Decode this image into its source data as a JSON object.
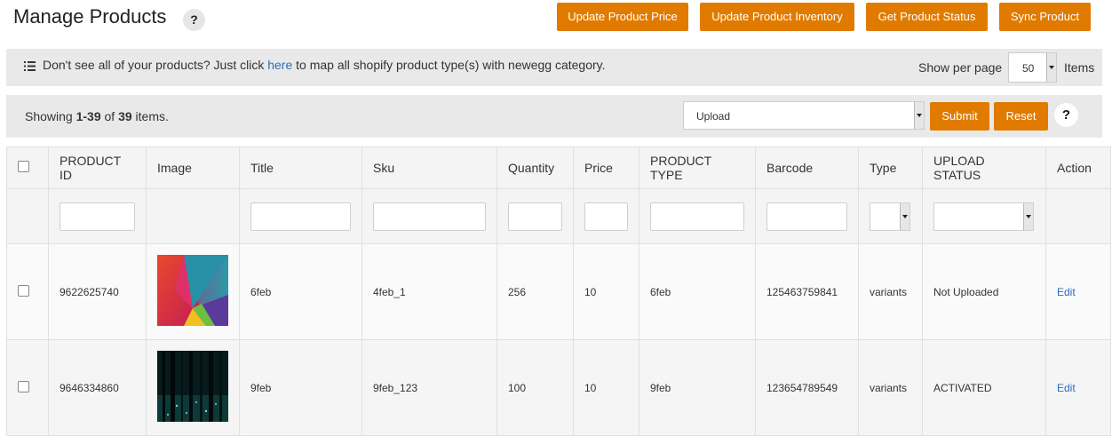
{
  "page": {
    "title": "Manage Products",
    "help_label": "?"
  },
  "toolbar": {
    "update_price": "Update Product Price",
    "update_inventory": "Update Product Inventory",
    "get_status": "Get Product Status",
    "sync_product": "Sync Product"
  },
  "notice": {
    "prefix": "Don't see all of your products? Just click ",
    "link": "here",
    "suffix": " to map all shopify product type(s) with newegg category.",
    "show_per_page_label": "Show per page",
    "per_page_value": "50",
    "items_label": "Items"
  },
  "summary": {
    "showing_prefix": "Showing ",
    "range": "1-39",
    "of": " of ",
    "total": "39",
    "items_suffix": " items."
  },
  "bulk": {
    "action_value": "Upload",
    "submit": "Submit",
    "reset": "Reset",
    "help": "?"
  },
  "table": {
    "headers": {
      "product_id": "PRODUCT ID",
      "image": "Image",
      "title": "Title",
      "sku": "Sku",
      "quantity": "Quantity",
      "price": "Price",
      "product_type": "PRODUCT TYPE",
      "barcode": "Barcode",
      "type": "Type",
      "upload_status": "UPLOAD STATUS",
      "action": "Action"
    },
    "rows": [
      {
        "product_id": "9622625740",
        "image": "abstract-triangles-image",
        "title": "6feb",
        "sku": "4feb_1",
        "quantity": "256",
        "price": "10",
        "product_type": "6feb",
        "barcode": "125463759841",
        "type": "variants",
        "upload_status": "Not Uploaded",
        "action": "Edit"
      },
      {
        "product_id": "9646334860",
        "image": "dark-forest-image",
        "title": "9feb",
        "sku": "9feb_123",
        "quantity": "100",
        "price": "10",
        "product_type": "9feb",
        "barcode": "123654789549",
        "type": "variants",
        "upload_status": "ACTIVATED",
        "action": "Edit"
      }
    ]
  },
  "colors": {
    "accent": "#e07b00",
    "link": "#2a6db8",
    "bar_bg": "#e9e9e9"
  }
}
